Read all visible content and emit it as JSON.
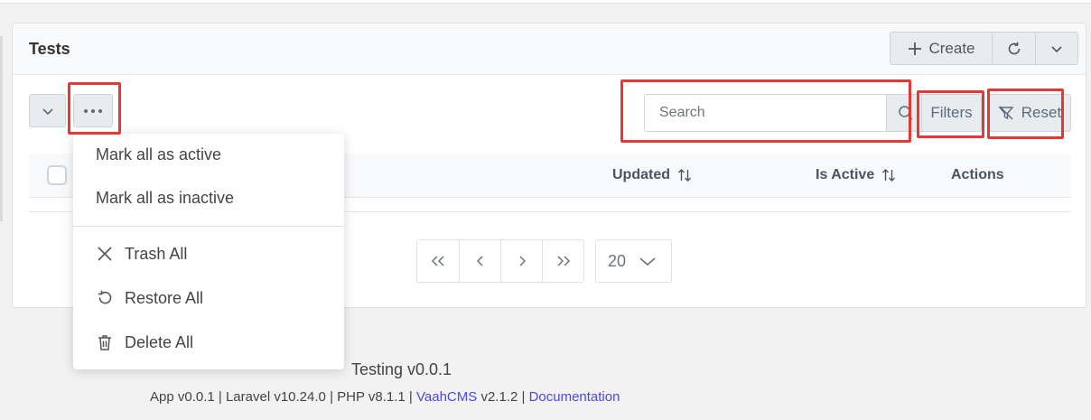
{
  "panel": {
    "title": "Tests"
  },
  "header_actions": {
    "create_label": "Create"
  },
  "toolbar": {
    "search_placeholder": "Search",
    "filters_label": "Filters",
    "reset_label": "Reset"
  },
  "table": {
    "columns": [
      {
        "label": "Updated",
        "sortable": true
      },
      {
        "label": "Is Active",
        "sortable": true
      },
      {
        "label": "Actions",
        "sortable": false
      }
    ]
  },
  "pagination": {
    "rows_per_page": "20"
  },
  "bulk_menu": {
    "items": [
      {
        "label": "Mark all as active",
        "icon": ""
      },
      {
        "label": "Mark all as inactive",
        "icon": ""
      },
      {
        "label": "Trash All",
        "icon": "close-icon"
      },
      {
        "label": "Restore All",
        "icon": "restore-icon"
      },
      {
        "label": "Delete All",
        "icon": "trash-icon"
      }
    ]
  },
  "footer": {
    "title": "Testing v0.0.1",
    "app_version": "App v0.0.1",
    "laravel_version": "Laravel v10.24.0",
    "php_version": "PHP v8.1.1",
    "vaahcms_link": "VaahCMS",
    "vaahcms_version": "v2.1.2",
    "docs_link": "Documentation",
    "separator": "|"
  },
  "colors": {
    "highlight": "#e53935",
    "link": "#4f46e5",
    "button_bg": "#e9ecef"
  }
}
